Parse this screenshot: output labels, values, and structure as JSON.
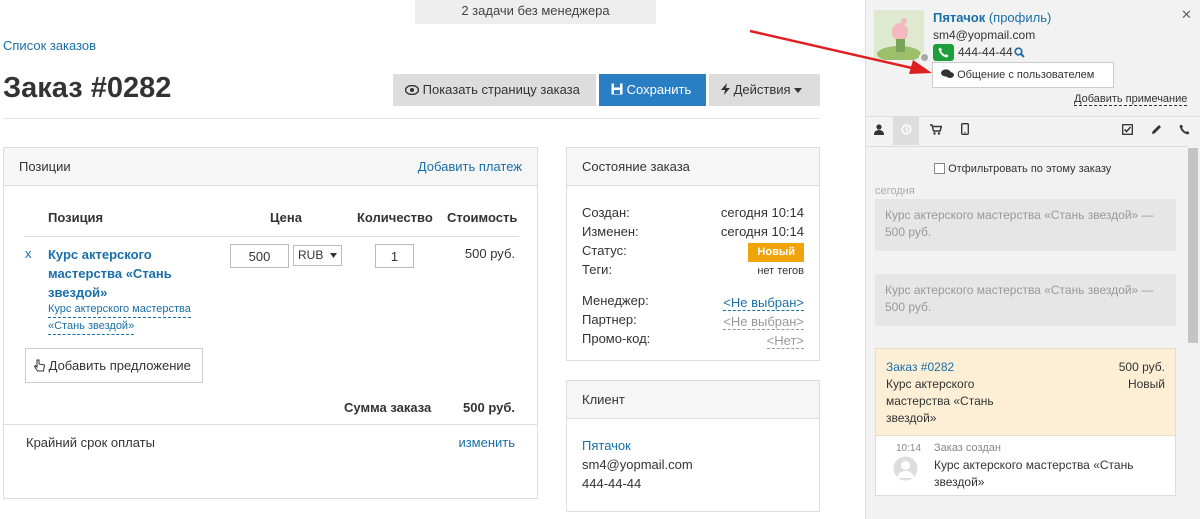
{
  "topbar": {
    "notice": "2 задачи без менеджера"
  },
  "breadcrumb": {
    "orders_link": "Список заказов"
  },
  "page": {
    "title": "Заказ #0282"
  },
  "toolbar": {
    "show_page_label": "Показать страницу заказа",
    "save_label": "Сохранить",
    "actions_label": "Действия"
  },
  "items_panel": {
    "title": "Позиции",
    "add_payment": "Добавить платеж",
    "col_item": "Позиция",
    "col_price": "Цена",
    "col_qty": "Количество",
    "col_cost": "Стоимость",
    "row": {
      "remove": "x",
      "name": "Курс актерского мастерства «Стань звездой»",
      "sub_line1": "Курс актерского мастерства",
      "sub_line2": "«Стань звездой»",
      "price": "500",
      "currency": "RUB",
      "qty": "1",
      "cost": "500 руб."
    },
    "add_offer": "Добавить предложение",
    "sum_label": "Сумма заказа",
    "sum_value": "500 руб.",
    "deadline_label": "Крайний срок оплаты",
    "deadline_link": "изменить"
  },
  "status_panel": {
    "title": "Состояние заказа",
    "created_label": "Создан:",
    "created_value": "сегодня 10:14",
    "changed_label": "Изменен:",
    "changed_value": "сегодня 10:14",
    "status_label": "Статус:",
    "status_value": "Новый",
    "tags_label": "Теги:",
    "tags_value": "нет тегов",
    "manager_label": "Менеджер:",
    "manager_value": "<Не выбран>",
    "partner_label": "Партнер:",
    "partner_value": "<Не выбран>",
    "promo_label": "Промо-код:",
    "promo_value": "<Нет>"
  },
  "client_panel": {
    "title": "Клиент",
    "name": "Пятачок",
    "email": "sm4@yopmail.com",
    "phone": "444-44-44"
  },
  "sidebar": {
    "user_name": "Пятачок",
    "profile_link": "(профиль)",
    "email": "sm4@yopmail.com",
    "phone": "444-44-44",
    "chat_button": "Общение с пользователем",
    "add_note": "Добавить примечание",
    "filter_label": "Отфильтровать по этому заказу",
    "today_label": "сегодня",
    "feed_items": [
      "Курс актерского мастерства «Стань звездой» — 500 руб.",
      "Курс актерского мастерства «Стань звездой» — 500 руб."
    ],
    "order_card": {
      "title": "Заказ #0282",
      "amount": "500 руб.",
      "desc": "Курс актерского мастерства «Стань звездой»",
      "status": "Новый"
    },
    "event": {
      "time": "10:14",
      "title": "Заказ создан",
      "desc": "Курс актерского мастерства «Стань звездой»"
    }
  },
  "colors": {
    "accent": "#2a7fc4",
    "status_new": "#f0a30a",
    "link": "#1a6fa8",
    "arrow": "#e02020"
  }
}
